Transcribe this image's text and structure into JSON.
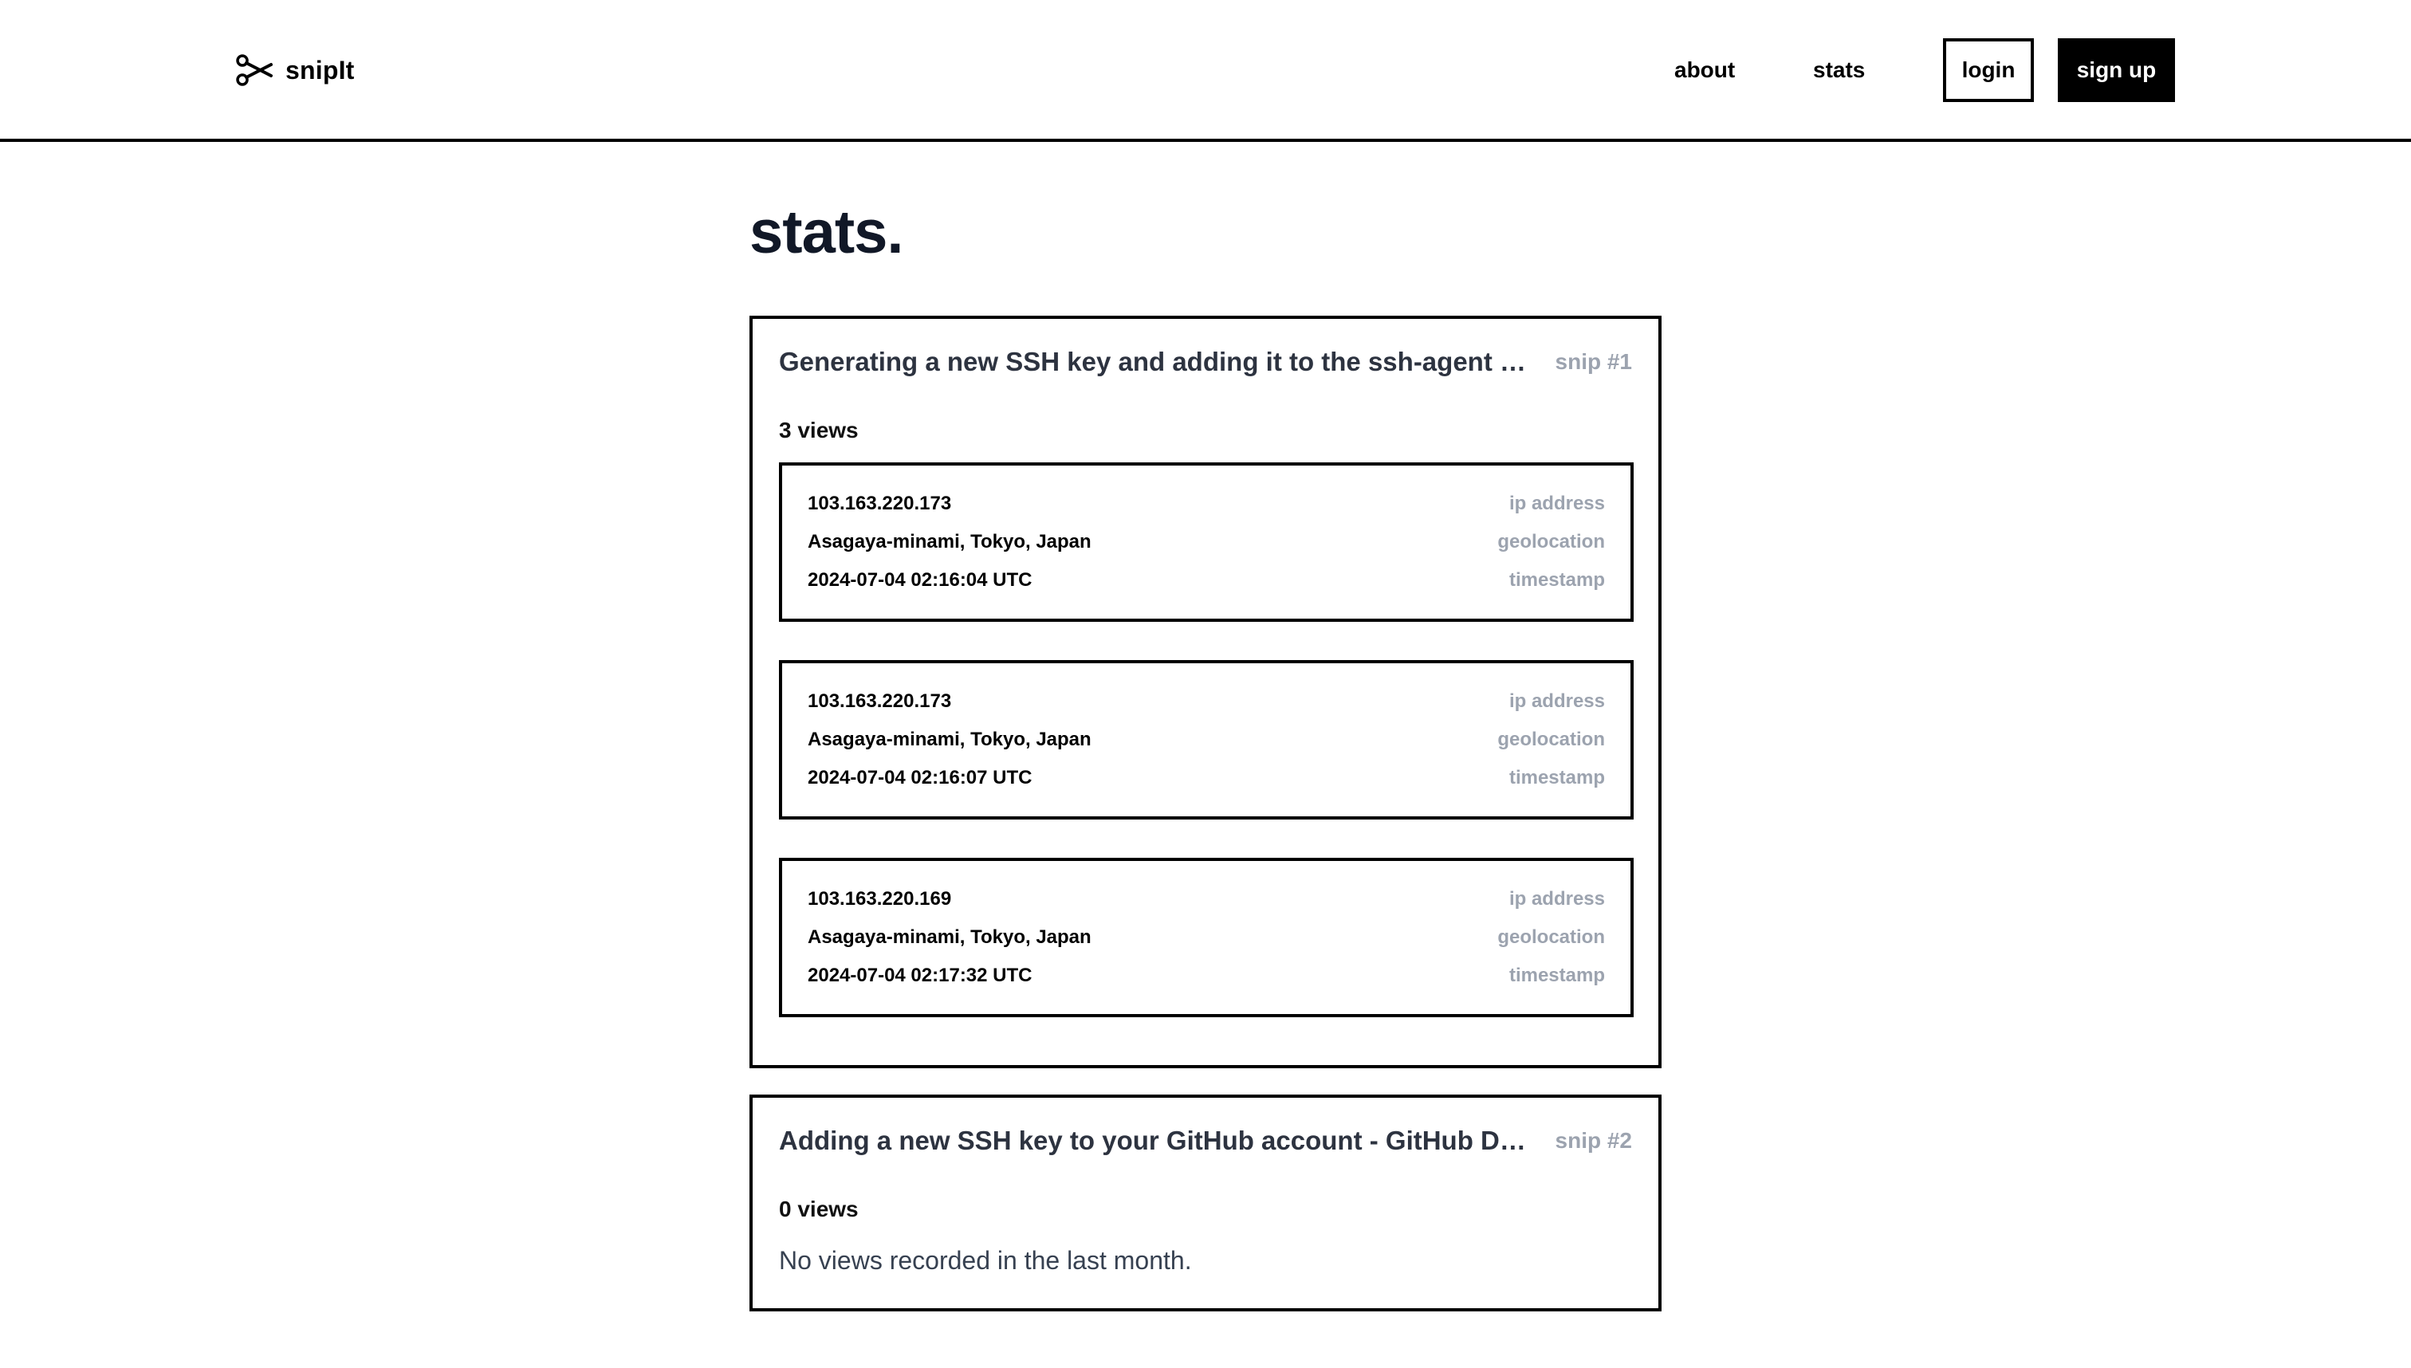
{
  "header": {
    "logo_text": "snipIt",
    "logo_icon": "scissors-icon",
    "nav": {
      "about": "about",
      "stats": "stats"
    },
    "login_label": "login",
    "signup_label": "sign up"
  },
  "page": {
    "title": "stats."
  },
  "snips": [
    {
      "title": "Generating a new SSH key and adding it to the ssh-agent -...",
      "number": "snip #1",
      "views_label": "3 views",
      "views": [
        {
          "ip": "103.163.220.173",
          "geolocation": "Asagaya-minami, Tokyo, Japan",
          "timestamp": "2024-07-04 02:16:04 UTC"
        },
        {
          "ip": "103.163.220.173",
          "geolocation": "Asagaya-minami, Tokyo, Japan",
          "timestamp": "2024-07-04 02:16:07 UTC"
        },
        {
          "ip": "103.163.220.169",
          "geolocation": "Asagaya-minami, Tokyo, Japan",
          "timestamp": "2024-07-04 02:17:32 UTC"
        }
      ]
    },
    {
      "title": "Adding a new SSH key to your GitHub account - GitHub Docs",
      "number": "snip #2",
      "views_label": "0 views",
      "empty_message": "No views recorded in the last month."
    }
  ],
  "labels": {
    "ip": "ip address",
    "geolocation": "geolocation",
    "timestamp": "timestamp"
  }
}
